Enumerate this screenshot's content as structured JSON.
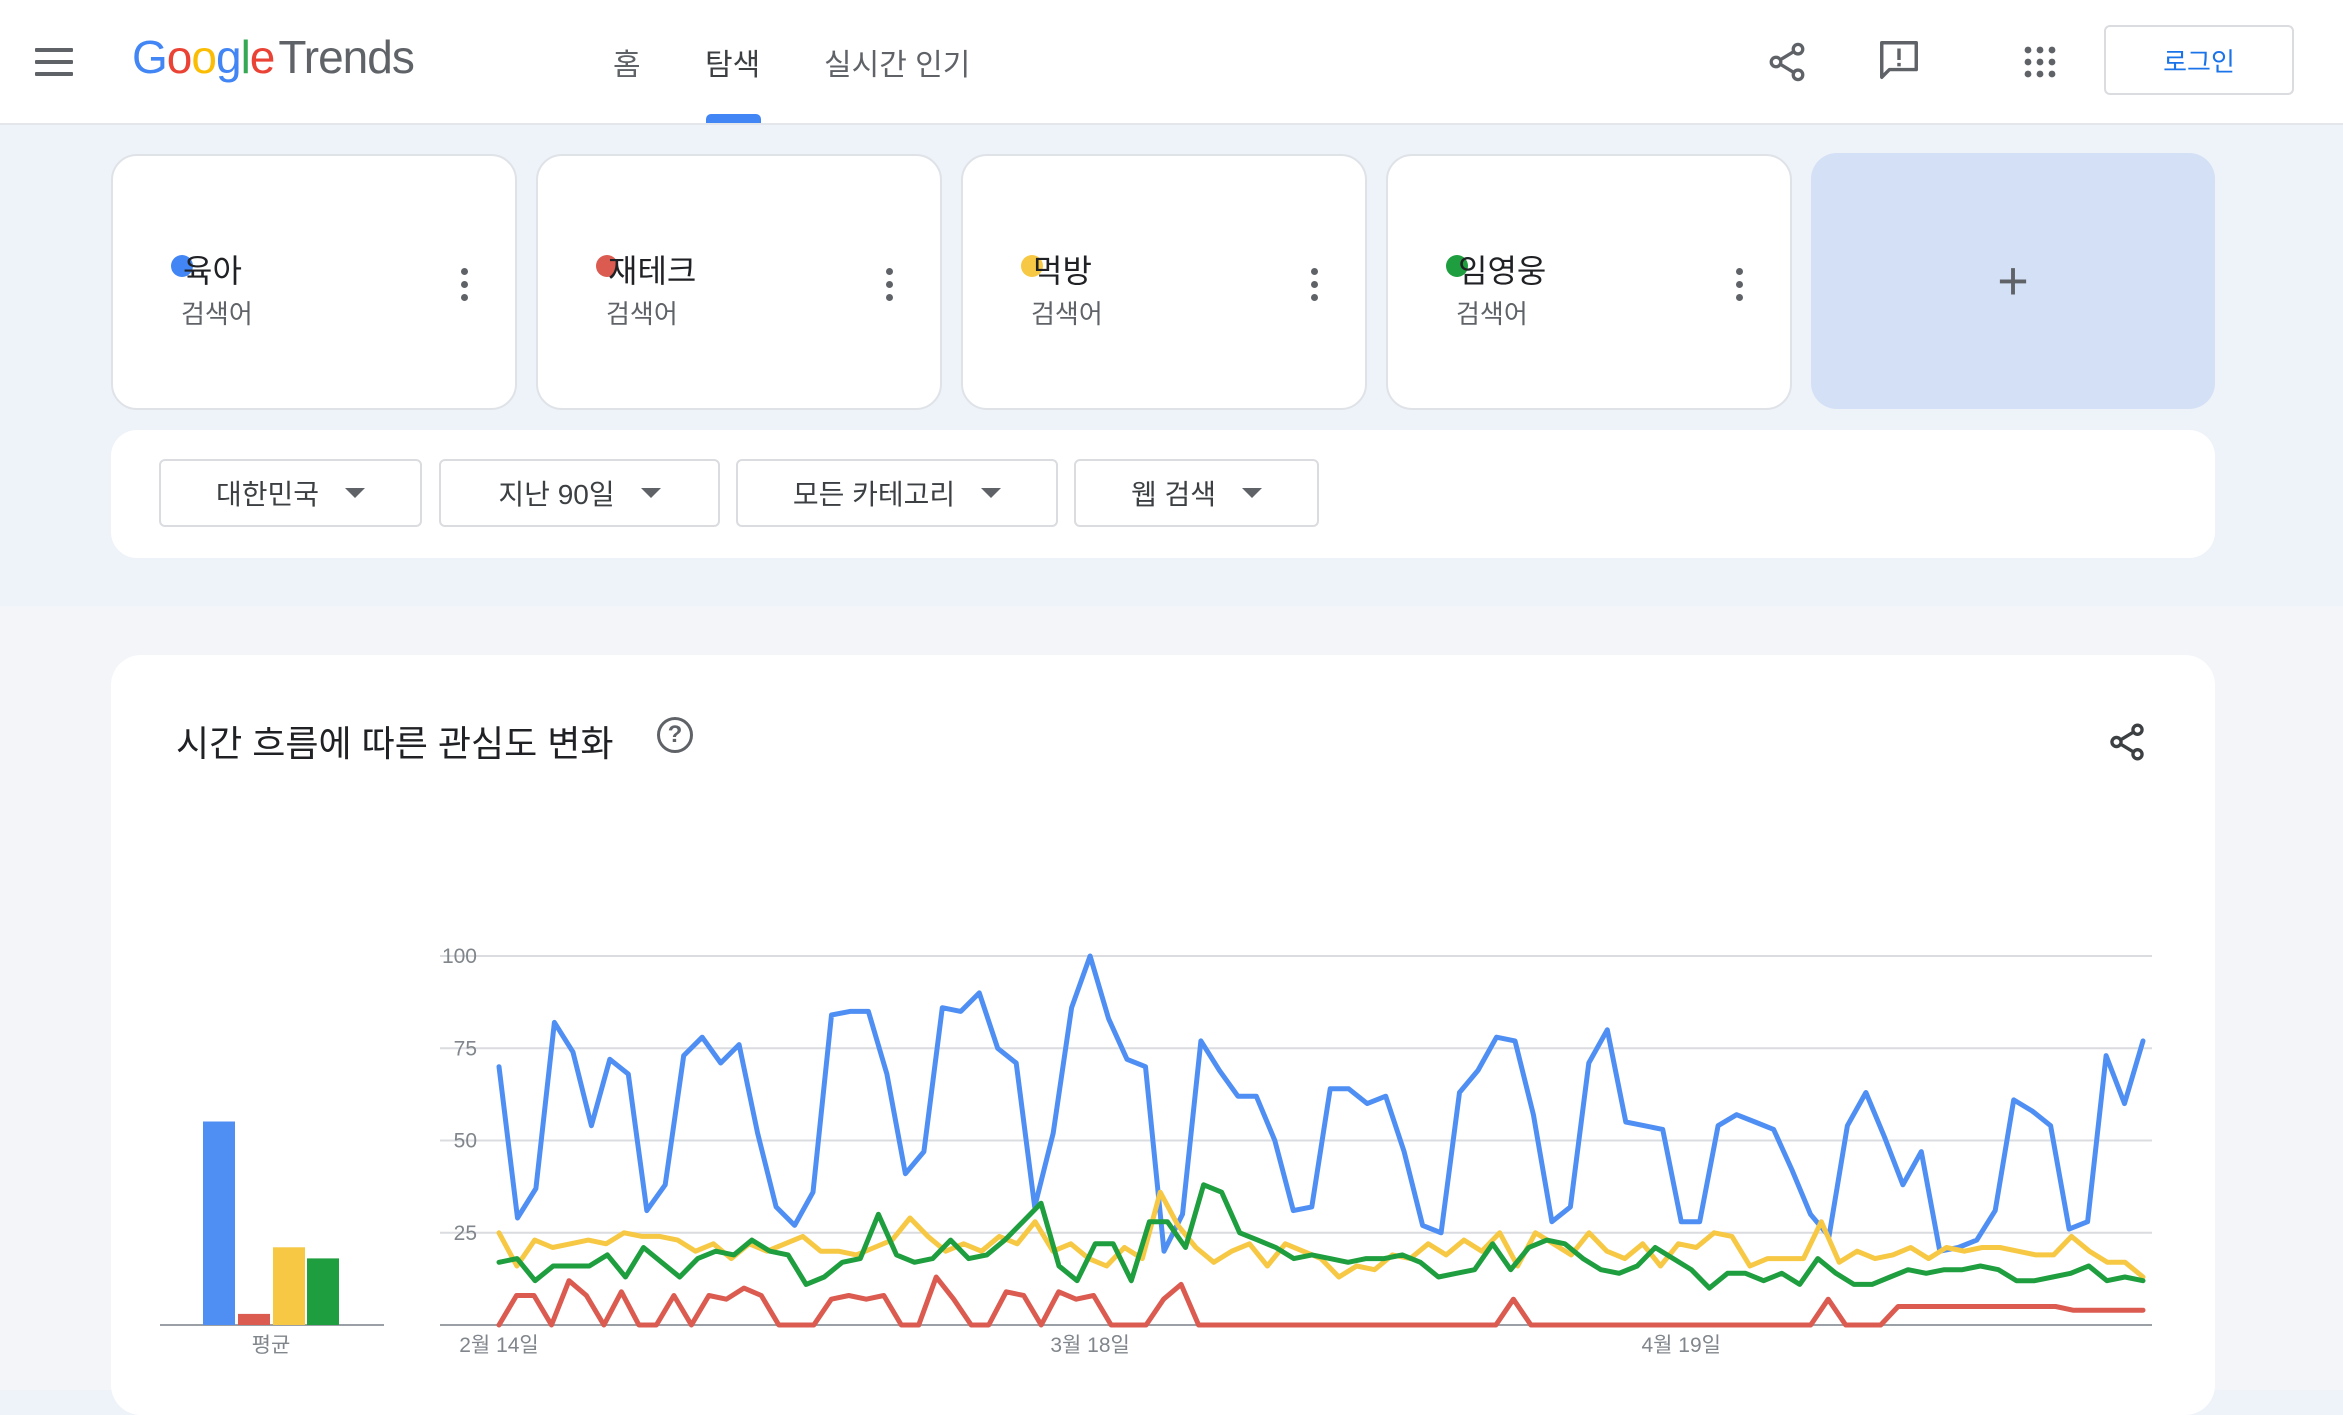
{
  "header": {
    "logo_google": [
      "G",
      "o",
      "o",
      "g",
      "l",
      "e"
    ],
    "logo_product": "Trends",
    "nav": [
      {
        "label": "홈",
        "active": false
      },
      {
        "label": "탐색",
        "active": true
      },
      {
        "label": "실시간 인기",
        "active": false
      }
    ],
    "icons": [
      "share-icon",
      "feedback-icon",
      "apps-grid-icon"
    ],
    "login_label": "로그인"
  },
  "terms": [
    {
      "name": "육아",
      "type": "검색어",
      "color": "#4285f4"
    },
    {
      "name": "재테크",
      "type": "검색어",
      "color": "#db5b50"
    },
    {
      "name": "먹방",
      "type": "검색어",
      "color": "#f6c844"
    },
    {
      "name": "임영웅",
      "type": "검색어",
      "color": "#1e9e3e"
    }
  ],
  "add_term_symbol": "+",
  "filters": [
    {
      "label": "대한민국"
    },
    {
      "label": "지난 90일"
    },
    {
      "label": "모든 카테고리"
    },
    {
      "label": "웹 검색"
    }
  ],
  "interest_section": {
    "title": "시간 흐름에 따른 관심도 변화",
    "help_symbol": "?"
  },
  "chart_data": [
    {
      "type": "bar",
      "categories": [
        "평균"
      ],
      "series": [
        {
          "name": "육아",
          "values": [
            55
          ],
          "color": "#4f8ff4"
        },
        {
          "name": "재테크",
          "values": [
            3
          ],
          "color": "#db5b50"
        },
        {
          "name": "먹방",
          "values": [
            21
          ],
          "color": "#f6c844"
        },
        {
          "name": "임영웅",
          "values": [
            18
          ],
          "color": "#1e9e3e"
        }
      ],
      "xlabel": "평균",
      "ylim": [
        0,
        100
      ]
    },
    {
      "type": "line",
      "x_tick_labels": [
        "2월 14일",
        "3월 18일",
        "4월 19일"
      ],
      "x_tick_index": [
        0,
        32,
        64
      ],
      "yticks": [
        25,
        50,
        75,
        100
      ],
      "ylim": [
        0,
        100
      ],
      "grid": true,
      "series": [
        {
          "name": "육아",
          "color": "#4f8ff4",
          "values": [
            70,
            29,
            37,
            82,
            74,
            54,
            72,
            68,
            31,
            38,
            73,
            78,
            71,
            76,
            52,
            32,
            27,
            36,
            84,
            85,
            85,
            68,
            41,
            47,
            86,
            85,
            90,
            75,
            71,
            32,
            52,
            86,
            100,
            83,
            72,
            70,
            20,
            30,
            77,
            69,
            62,
            62,
            50,
            31,
            32,
            64,
            64,
            60,
            62,
            47,
            27,
            25,
            63,
            69,
            78,
            77,
            57,
            28,
            32,
            71,
            80,
            55,
            54,
            53,
            28,
            28,
            54,
            57,
            55,
            53,
            42,
            30,
            24,
            54,
            63,
            51,
            38,
            47,
            20,
            21,
            23,
            31,
            61,
            58,
            54,
            26,
            28,
            73,
            60,
            77
          ]
        },
        {
          "name": "재테크",
          "color": "#db5b50",
          "values": [
            0,
            8,
            8,
            0,
            12,
            8,
            0,
            9,
            0,
            0,
            8,
            0,
            8,
            7,
            10,
            8,
            0,
            0,
            0,
            7,
            8,
            7,
            8,
            0,
            0,
            13,
            7,
            0,
            0,
            9,
            8,
            0,
            9,
            7,
            8,
            0,
            0,
            0,
            7,
            11,
            0,
            0,
            0,
            0,
            0,
            0,
            0,
            0,
            0,
            0,
            0,
            0,
            0,
            0,
            0,
            0,
            0,
            0,
            7,
            0,
            0,
            0,
            0,
            0,
            0,
            0,
            0,
            0,
            0,
            0,
            0,
            0,
            0,
            0,
            0,
            0,
            7,
            0,
            0,
            0,
            5,
            5,
            5,
            5,
            5,
            5,
            5,
            5,
            5,
            5,
            4,
            4,
            4,
            4,
            4
          ]
        },
        {
          "name": "먹방",
          "color": "#f6c844",
          "values": [
            25,
            16,
            23,
            21,
            22,
            23,
            22,
            25,
            24,
            24,
            23,
            20,
            22,
            18,
            22,
            20,
            22,
            24,
            20,
            20,
            19,
            21,
            23,
            29,
            24,
            20,
            22,
            20,
            24,
            22,
            28,
            20,
            22,
            18,
            16,
            21,
            18,
            36,
            27,
            21,
            17,
            20,
            22,
            16,
            22,
            20,
            18,
            13,
            16,
            15,
            19,
            18,
            22,
            19,
            23,
            20,
            25,
            16,
            25,
            22,
            19,
            25,
            20,
            18,
            22,
            16,
            22,
            21,
            25,
            24,
            16,
            18,
            18,
            18,
            28,
            17,
            20,
            18,
            19,
            21,
            18,
            21,
            20,
            21,
            21,
            20,
            19,
            19,
            24,
            20,
            17,
            17,
            13
          ]
        },
        {
          "name": "임영웅",
          "color": "#1e9e3e",
          "values": [
            17,
            18,
            12,
            16,
            16,
            16,
            19,
            13,
            21,
            17,
            13,
            18,
            20,
            19,
            23,
            20,
            19,
            11,
            13,
            17,
            18,
            30,
            19,
            17,
            18,
            23,
            18,
            19,
            23,
            28,
            33,
            16,
            12,
            22,
            22,
            12,
            28,
            28,
            21,
            38,
            36,
            25,
            23,
            21,
            18,
            19,
            18,
            17,
            18,
            18,
            19,
            17,
            13,
            14,
            15,
            22,
            15,
            21,
            23,
            22,
            18,
            15,
            14,
            16,
            21,
            18,
            15,
            10,
            14,
            14,
            12,
            14,
            11,
            18,
            14,
            11,
            11,
            13,
            15,
            14,
            15,
            15,
            16,
            15,
            12,
            12,
            13,
            14,
            16,
            12,
            13,
            12
          ]
        }
      ]
    }
  ]
}
